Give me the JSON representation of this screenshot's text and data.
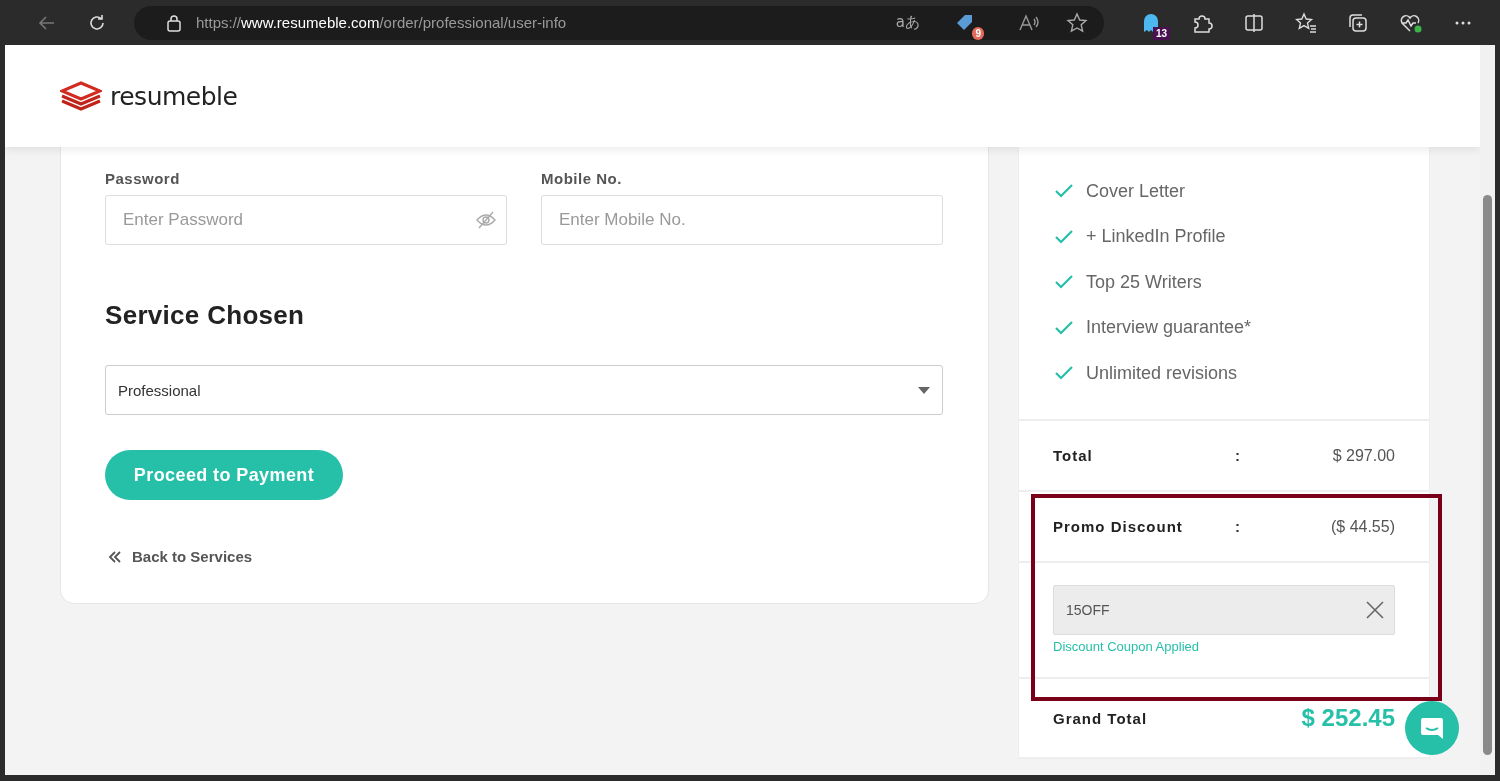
{
  "browser": {
    "url_scheme": "https://",
    "url_host": "www.resumeble.com",
    "url_path": "/order/professional/user-info",
    "translate_glyph": "aあ",
    "shopping_badge": "9",
    "extension_badge": "13"
  },
  "brand": {
    "name": "resumeble"
  },
  "form": {
    "fields": [
      {
        "label": "Password",
        "placeholder": "Enter Password",
        "kind": "password"
      },
      {
        "label": "Mobile No.",
        "placeholder": "Enter Mobile No.",
        "kind": "text"
      }
    ],
    "section_title": "Service Chosen",
    "service": {
      "value": "Professional"
    },
    "submit": "Proceed to Payment",
    "back_link": "Back to Services"
  },
  "summary": {
    "features": [
      "Cover Letter",
      "+ LinkedIn Profile",
      "Top 25 Writers",
      "Interview guarantee*",
      "Unlimited revisions"
    ],
    "rows": [
      {
        "label": "Total",
        "separator": ":",
        "value": "$ 297.00"
      },
      {
        "label": "Promo Discount",
        "separator": ":",
        "value": "($ 44.55)"
      }
    ],
    "coupon": {
      "value": "15OFF",
      "status": "Discount Coupon Applied"
    },
    "grand_total": {
      "label": "Grand Total",
      "value": "$ 252.45"
    }
  }
}
